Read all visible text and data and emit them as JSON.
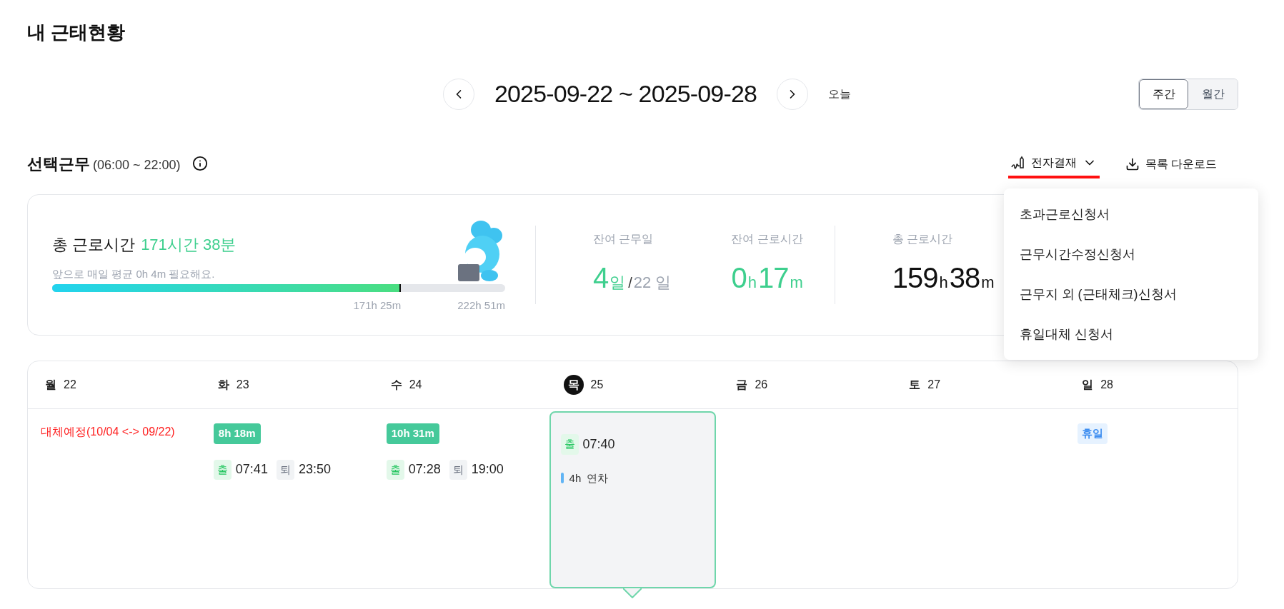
{
  "page_title": "내 근태현황",
  "date_nav": {
    "range": "2025-09-22 ~ 2025-09-28",
    "today_button": "오늘"
  },
  "view_toggle": [
    {
      "label": "주간",
      "selected": true
    },
    {
      "label": "월간",
      "selected": false
    }
  ],
  "section": {
    "title": "선택근무",
    "hours": "(06:00 ~ 22:00)"
  },
  "actions": [
    {
      "label": "전자결재",
      "kind": "approval",
      "expanded": true
    },
    {
      "label": "목록 다운로드",
      "kind": "download"
    }
  ],
  "menu": [
    "초과근로신청서",
    "근무시간수정신청서",
    "근무지 외 (근태체크)신청서",
    "휴일대체 신청서"
  ],
  "summary": {
    "label": "총 근로시간",
    "value": "171시간 38분",
    "hint": "앞으로 매일 평균 0h 4m 필요해요.",
    "progress": {
      "level": 0.77,
      "current": "171h 25m",
      "target": "222h 51m"
    },
    "stat_groups": [
      [
        {
          "label": "잔여 근무일",
          "highlight": true,
          "parts": [
            {
              "text": "4",
              "kind": "number"
            },
            {
              "text": "일",
              "kind": "unit"
            },
            {
              "text": "/",
              "kind": "slash"
            },
            {
              "text": "22 일",
              "kind": "total"
            }
          ]
        },
        {
          "label": "잔여 근로시간",
          "highlight": true,
          "parts": [
            {
              "text": "0",
              "kind": "number"
            },
            {
              "text": "h",
              "kind": "unit"
            },
            {
              "text": "17",
              "kind": "number"
            },
            {
              "text": "m",
              "kind": "unit"
            }
          ]
        }
      ],
      [
        {
          "label": "총 근로시간",
          "highlight": false,
          "parts": [
            {
              "text": "159",
              "kind": "number"
            },
            {
              "text": "h",
              "kind": "unit"
            },
            {
              "text": "38",
              "kind": "number"
            },
            {
              "text": "m",
              "kind": "unit"
            }
          ]
        }
      ]
    ]
  },
  "week": [
    {
      "day": "월",
      "date": "22",
      "today": false,
      "selected": false,
      "entries": [
        {
          "kind": "note",
          "text": "대체예정(10/04 <-> 09/22)"
        }
      ]
    },
    {
      "day": "화",
      "date": "23",
      "today": false,
      "selected": false,
      "entries": [
        {
          "kind": "duration",
          "text": "8h 18m"
        },
        {
          "kind": "punches",
          "items": [
            {
              "kind": "in",
              "tag": "출",
              "time": "07:41"
            },
            {
              "kind": "out",
              "tag": "퇴",
              "time": "23:50"
            }
          ]
        }
      ]
    },
    {
      "day": "수",
      "date": "24",
      "today": false,
      "selected": false,
      "entries": [
        {
          "kind": "duration",
          "text": "10h 31m"
        },
        {
          "kind": "punches",
          "items": [
            {
              "kind": "in",
              "tag": "출",
              "time": "07:28"
            },
            {
              "kind": "out",
              "tag": "퇴",
              "time": "19:00"
            }
          ]
        }
      ]
    },
    {
      "day": "목",
      "date": "25",
      "today": true,
      "selected": true,
      "entries": [
        {
          "kind": "punches",
          "items": [
            {
              "kind": "in",
              "tag": "출",
              "time": "07:40"
            }
          ]
        },
        {
          "kind": "leave",
          "amount": "4h",
          "text": "연차"
        }
      ]
    },
    {
      "day": "금",
      "date": "26",
      "today": false,
      "selected": false
    },
    {
      "day": "토",
      "date": "27",
      "today": false,
      "selected": false
    },
    {
      "day": "일",
      "date": "28",
      "today": false,
      "selected": false,
      "entries": [
        {
          "kind": "holiday",
          "text": "휴일"
        }
      ]
    }
  ]
}
